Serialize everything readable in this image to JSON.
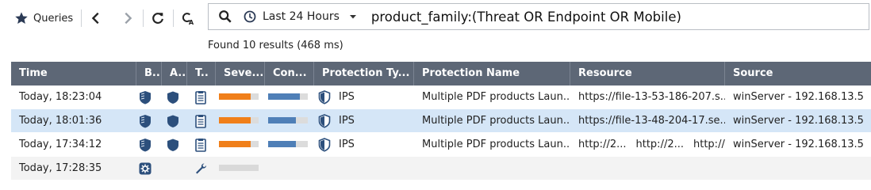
{
  "toolbar": {
    "queries_label": "Queries",
    "icons": [
      "star-icon",
      "back-arrow-icon",
      "forward-arrow-icon",
      "refresh-icon",
      "search-clear-icon"
    ]
  },
  "search": {
    "time_range": "Last 24 Hours",
    "query": "product_family:(Threat OR Endpoint OR Mobile)"
  },
  "results_text": "Found 10 results (468 ms)",
  "columns": [
    "Time",
    "B..",
    "A..",
    "T..",
    "Seve...",
    "Con...",
    "Protection Ty...",
    "Protection Name",
    "Resource",
    "Source"
  ],
  "rows": [
    {
      "time": "Today, 18:23:04",
      "severity": 0.8,
      "confidence": 0.8,
      "protection_type": "IPS",
      "protection_name": "Multiple PDF products Laun...",
      "resource": [
        "https://file-13-53-186-207.s..."
      ],
      "source": "winServer - 192.168.13.5...",
      "selected": false
    },
    {
      "time": "Today, 18:01:36",
      "severity": 0.8,
      "confidence": 0.7,
      "protection_type": "IPS",
      "protection_name": "Multiple PDF products Laun...",
      "resource": [
        "https://file-13-48-204-17.se..."
      ],
      "source": "winServer - 192.168.13.5...",
      "selected": true
    },
    {
      "time": "Today, 17:34:12",
      "severity": 0.8,
      "confidence": 0.7,
      "protection_type": "IPS",
      "protection_name": "Multiple PDF products Laun...",
      "resource": [
        "http://2...",
        "http://2...",
        "http://2..."
      ],
      "source": "winServer - 192.168.13.5...",
      "selected": false
    },
    {
      "time": "Today, 17:28:35",
      "severity": null,
      "confidence": null,
      "protection_type": "",
      "protection_name": "",
      "resource": [],
      "source": "",
      "selected": false
    }
  ],
  "colors": {
    "header_bg": "#5d6776",
    "selected_row": "#d5e6f7",
    "severity": "#f07f1a",
    "confidence": "#4f7fb7",
    "blade_icon": "#2c4f7c"
  }
}
